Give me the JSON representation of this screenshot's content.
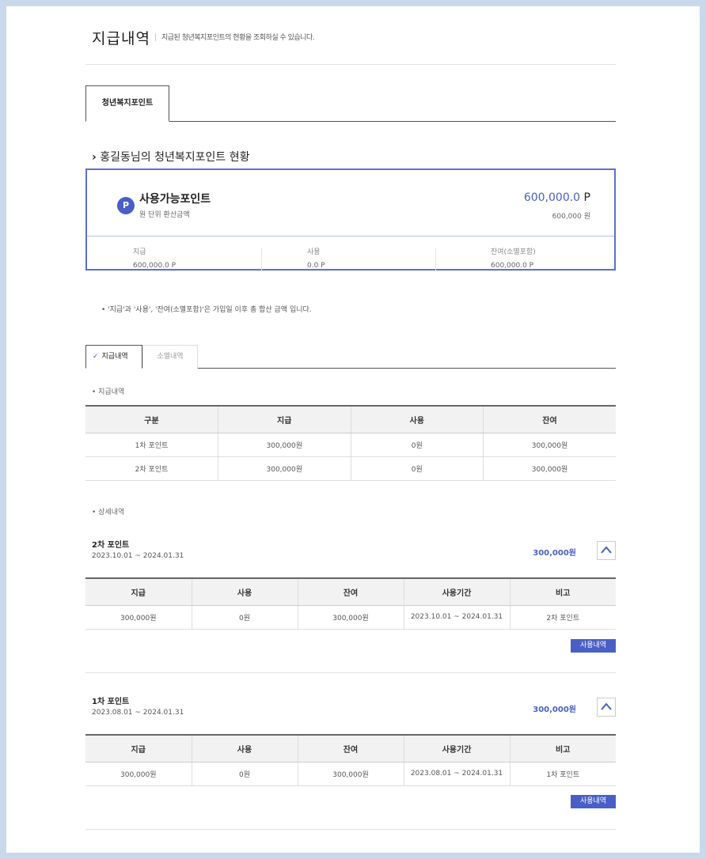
{
  "header": {
    "title": "지급내역",
    "desc": "지급된 청년복지포인트의 현황을 조회하실 수 있습니다."
  },
  "tab": {
    "label": "청년복지포인트"
  },
  "section": {
    "name": "홍길동",
    "suffix": "님의 청년복지포인트 현황"
  },
  "points": {
    "icon": "P",
    "label": "사용가능포인트",
    "sub": "원 단위 환산금액",
    "value": "600,000.0",
    "unit": "P",
    "won": "600,000 원",
    "stats": [
      {
        "label": "지급",
        "value": "600,000.0  P"
      },
      {
        "label": "사용",
        "value": "0.0  P"
      },
      {
        "label": "잔여(소멸포함)",
        "value": "600,000.0  P"
      }
    ]
  },
  "note": "• '지급'과 '사용', '잔여(소멸포함)'은 가입일 이후 총 합산 금액 입니다.",
  "subtabs": {
    "active": "지급내역",
    "inactive": "소멸내역",
    "check": "✓"
  },
  "summary": {
    "bullet": "• 지급내역",
    "columns": [
      "구분",
      "지급",
      "사용",
      "잔여"
    ],
    "rows": [
      [
        "1차 포인트",
        "300,000원",
        "0원",
        "300,000원"
      ],
      [
        "2차 포인트",
        "300,000원",
        "0원",
        "300,000원"
      ]
    ]
  },
  "detail": {
    "bullet": "• 상세내역",
    "columns": [
      "지급",
      "사용",
      "잔여",
      "사용기간",
      "비고"
    ],
    "use_button": "사용내역",
    "items": [
      {
        "name": "2차 포인트",
        "period": "2023.10.01 ~ 2024.01.31",
        "amount": "300,000원",
        "row": [
          "300,000원",
          "0원",
          "300,000원",
          "2023.10.01 ~ 2024.01.31",
          "2차 포인트"
        ]
      },
      {
        "name": "1차 포인트",
        "period": "2023.08.01 ~ 2024.01.31",
        "amount": "300,000원",
        "row": [
          "300,000원",
          "0원",
          "300,000원",
          "2023.08.01 ~ 2024.01.31",
          "1차 포인트"
        ]
      }
    ]
  },
  "colors": {
    "accent": "#4a5fc5",
    "frame": "#c7d9ea"
  },
  "nav": {
    "prev_icon": "chevron-left-icon",
    "next_icon": "chevron-right-icon"
  }
}
